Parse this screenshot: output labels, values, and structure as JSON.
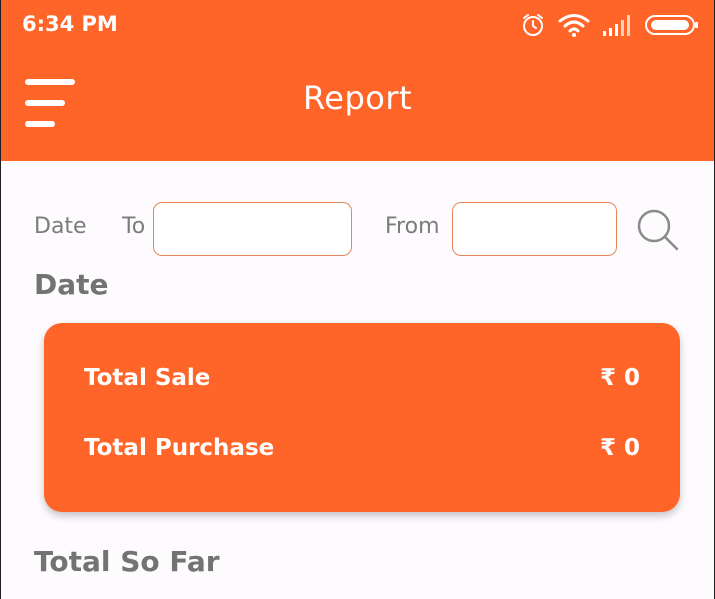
{
  "status_bar": {
    "time": "6:34 PM",
    "icons": [
      "alarm-icon",
      "wifi-icon",
      "signal-icon",
      "battery-icon"
    ]
  },
  "app_bar": {
    "title": "Report",
    "menu_icon": "hamburger-menu-icon"
  },
  "filter": {
    "date_label": "Date",
    "to_label": "To",
    "to_value": "",
    "from_label": "From",
    "from_value": "",
    "search_icon": "search-icon"
  },
  "date_section": {
    "title": "Date",
    "card": {
      "rows": [
        {
          "label": "Total Sale",
          "value": "₹ 0"
        },
        {
          "label": "Total Purchase",
          "value": "₹ 0"
        }
      ]
    }
  },
  "total_section": {
    "title": "Total So Far"
  },
  "colors": {
    "brand": "#ff6428",
    "input_border": "#e3875b",
    "label_text": "#7c7c7c",
    "section_text": "#737373",
    "background": "#fdfbfd"
  }
}
